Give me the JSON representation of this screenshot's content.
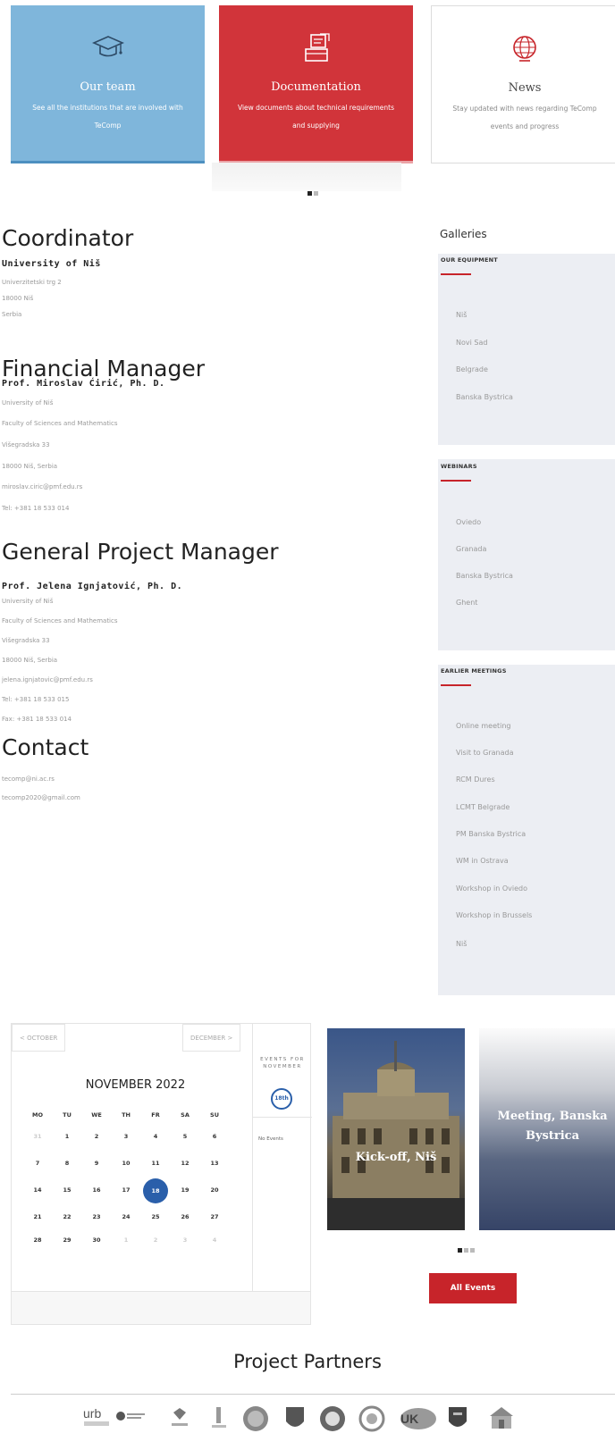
{
  "cards": [
    {
      "title": "Our team",
      "desc": "See all the institutions that are involved with TeComp",
      "icon": "graduation-cap-icon"
    },
    {
      "title": "Documentation",
      "desc": "View documents about technical requirements and supplying",
      "icon": "document-tray-icon"
    },
    {
      "title": "News",
      "desc": "Stay updated with news regarding TeComp events and progress",
      "icon": "globe-icon"
    }
  ],
  "coordinator": {
    "heading": "Coordinator",
    "name": "University of Niš",
    "lines": [
      "Univerzitetski trg 2",
      "18000 Niš",
      "Serbia"
    ]
  },
  "financial": {
    "heading": "Financial Manager",
    "name": "Prof. Miroslav Ćirić, Ph. D.",
    "lines": [
      "University of Niš",
      "Faculty of Sciences and Mathematics",
      "Višegradska 33",
      "18000 Niš, Serbia",
      "miroslav.ciric@pmf.edu.rs",
      "Tel: +381 18 533 014"
    ]
  },
  "general": {
    "heading": "General Project Manager",
    "name": "Prof. Jelena Ignjatović, Ph. D.",
    "lines": [
      "University of Niš",
      "Faculty of Sciences and Mathematics",
      "Višegradska 33",
      "18000 Niš, Serbia",
      "jelena.ignjatovic@pmf.edu.rs",
      "Tel: +381 18 533 015",
      "Fax: +381 18 533 014"
    ]
  },
  "contact": {
    "heading": "Contact",
    "lines": [
      "tecomp@ni.ac.rs",
      "tecomp2020@gmail.com"
    ]
  },
  "galleries": {
    "title": "Galleries",
    "sections": [
      {
        "label": "OUR EQUIPMENT",
        "items": [
          "Niš",
          "Novi Sad",
          "Belgrade",
          "Banska Bystrica"
        ]
      },
      {
        "label": "WEBINARS",
        "items": [
          "Oviedo",
          "Granada",
          "Banska Bystrica",
          "Ghent"
        ]
      },
      {
        "label": "EARLIER MEETINGS",
        "items": [
          "Online meeting",
          "Visit to Granada",
          "RCM Dures",
          "LCMT Belgrade",
          "PM Banska Bystrica",
          "WM in Ostrava",
          "Workshop in Oviedo",
          "Workshop in Brussels",
          "Niš"
        ]
      }
    ]
  },
  "calendar": {
    "prev": "< OCTOBER",
    "next": "DECEMBER >",
    "month": "NOVEMBER 2022",
    "weekdays": [
      "MO",
      "TU",
      "WE",
      "TH",
      "FR",
      "SA",
      "SU"
    ],
    "weeks": [
      [
        "31",
        "1",
        "2",
        "3",
        "4",
        "5",
        "6"
      ],
      [
        "7",
        "8",
        "9",
        "10",
        "11",
        "12",
        "13"
      ],
      [
        "14",
        "15",
        "16",
        "17",
        "18",
        "19",
        "20"
      ],
      [
        "21",
        "22",
        "23",
        "24",
        "25",
        "26",
        "27"
      ],
      [
        "28",
        "29",
        "30",
        "1",
        "2",
        "3",
        "4"
      ]
    ],
    "today": "18",
    "events_label": "EVENTS FOR NOVEMBER",
    "events_badge": "18th",
    "events_note": "No Events"
  },
  "events": [
    {
      "title": "Kick-off, Niš"
    },
    {
      "title": "Meeting, Banska Bystrica"
    }
  ],
  "all_events": "All Events",
  "partners_title": "Project Partners",
  "partner_logos": [
    "urb-logo",
    "university-logo",
    "crest-logo",
    "tower-logo",
    "seal-logo",
    "shield-logo",
    "round-seal-logo",
    "circle-logo",
    "uk-logo",
    "shield-2-logo",
    "building-logo"
  ]
}
